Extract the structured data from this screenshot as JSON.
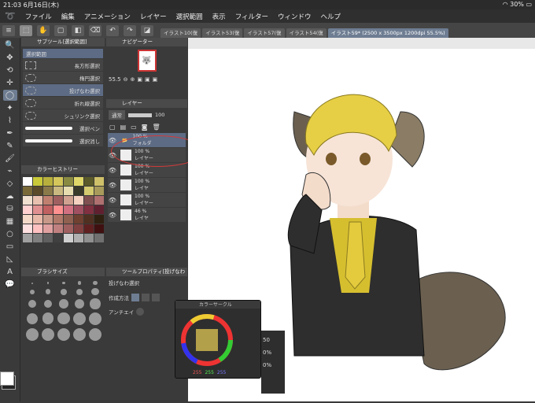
{
  "status": {
    "time": "21:03",
    "date": "6月16日(木)",
    "wifi_icon": "wifi-icon",
    "battery": "30%"
  },
  "menu": [
    "ファイル",
    "編集",
    "アニメーション",
    "レイヤー",
    "選択範囲",
    "表示",
    "フィルター",
    "ウィンドウ",
    "ヘルプ"
  ],
  "tabs": [
    {
      "label": "イラスト10(復"
    },
    {
      "label": "イラスト53(復"
    },
    {
      "label": "イラスト57(復"
    },
    {
      "label": "イラスト54(復"
    },
    {
      "label": "イラスト59* (2500 x 3500px 1200dpi 55.5%)"
    }
  ],
  "subtool": {
    "header": "サブツール[選択範囲]",
    "group": "選択範囲",
    "items": [
      {
        "label": "長方形選択"
      },
      {
        "label": "楕円選択"
      },
      {
        "label": "投げなわ選択"
      },
      {
        "label": "折れ線選択"
      },
      {
        "label": "シュリンク選択"
      },
      {
        "label": "選択ペン"
      },
      {
        "label": "選択消し"
      }
    ]
  },
  "color_history": {
    "header": "カラーヒストリー"
  },
  "brush_size": {
    "header": "ブラシサイズ",
    "values": [
      "0.7",
      "1",
      "1.5",
      "2",
      "2.5",
      "3",
      "4",
      "5",
      "6",
      "7",
      "8",
      "10",
      "12",
      "15",
      "17",
      "20",
      "25",
      "30",
      "40",
      "50",
      "60",
      "70",
      "80",
      "100",
      "120",
      "150",
      "170",
      "200",
      "250",
      "300"
    ]
  },
  "navigator": {
    "header": "ナビゲーター",
    "zoom": "55.5"
  },
  "layers": {
    "header": "レイヤー",
    "blend": "通常",
    "opacity": "100",
    "rows": [
      {
        "opacity": "100 %",
        "name": "フォルダ"
      },
      {
        "opacity": "100 %",
        "name": "レイヤー"
      },
      {
        "opacity": "100 %",
        "name": "レイヤー"
      },
      {
        "opacity": "100 %",
        "name": "レイヤ"
      },
      {
        "opacity": "100 %",
        "name": "レイヤー"
      },
      {
        "opacity": "46 %",
        "name": "レイヤ"
      }
    ]
  },
  "tool_property": {
    "header": "ツールプロパティ[投げなわ",
    "tool_name": "投げなわ選択",
    "mode_label": "作成方法",
    "aa_label": "アンチエイ"
  },
  "color_circle": {
    "header": "カラーサークル",
    "r": "255",
    "g": "255",
    "b": "255"
  },
  "side_values": [
    "50",
    "0%",
    "0%"
  ],
  "colors": {
    "accent": "#6e7d92",
    "annotation_red": "#d23a3a",
    "hair": "#e6cf45",
    "suit": "#2a2a2a"
  }
}
